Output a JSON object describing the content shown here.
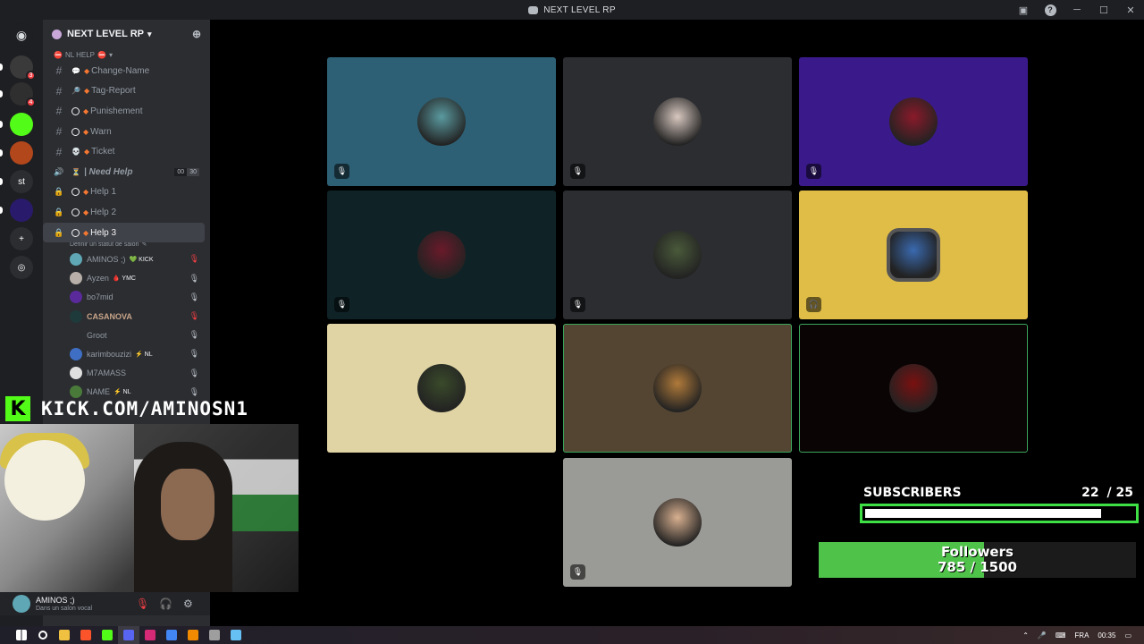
{
  "window": {
    "title": "NEXT LEVEL RP"
  },
  "server": {
    "name": "NEXT LEVEL RP",
    "category": "NL HELP"
  },
  "server_rail": {
    "items": [
      {
        "icon": "discord-home-icon",
        "color": "#1e1f22"
      },
      {
        "icon": "server-icon",
        "color": "#3a3a3a",
        "badge": "3"
      },
      {
        "icon": "server-icon",
        "color": "#2f2f2f",
        "badge": "4"
      },
      {
        "icon": "kick-server-icon",
        "color": "#53fc18"
      },
      {
        "icon": "server-icon",
        "color": "#b3471c"
      },
      {
        "icon": "server-icon",
        "color": "#2b2d31",
        "label": "st"
      },
      {
        "icon": "server-icon",
        "color": "#2a1a6b"
      },
      {
        "icon": "add-server-icon",
        "color": "#2b2d31",
        "label": "+"
      },
      {
        "icon": "explore-icon",
        "color": "#2b2d31",
        "label": "◎"
      }
    ]
  },
  "channels": [
    {
      "type": "text",
      "name": "Change-Name",
      "emoji": "speech"
    },
    {
      "type": "text",
      "name": "Tag-Report",
      "emoji": "magnifier"
    },
    {
      "type": "text",
      "name": "Punishement",
      "emoji": "ban"
    },
    {
      "type": "text",
      "name": "Warn",
      "emoji": "ban"
    },
    {
      "type": "text",
      "name": "Ticket",
      "emoji": "skull"
    },
    {
      "type": "voice",
      "name": "| Need Help",
      "emoji": "hourglass",
      "count": "00",
      "limit": "30"
    },
    {
      "type": "locked",
      "name": "Help 1",
      "emoji": "ban"
    },
    {
      "type": "locked",
      "name": "Help 2",
      "emoji": "ban"
    },
    {
      "type": "locked",
      "name": "Help 3",
      "emoji": "ban",
      "active": true
    }
  ],
  "active_channel_status": "Définir un statut de salon",
  "voice_users": [
    {
      "name": "AMINOS ;)",
      "tag": "💚 KICK",
      "color": "#5fa7b5",
      "muted_red": true
    },
    {
      "name": "Ayzen",
      "tag": "🩸 YMC",
      "color": "#b8b0a8",
      "muted_red": false
    },
    {
      "name": "bo7mid",
      "tag": "",
      "color": "#5b2a9a",
      "muted_red": false
    },
    {
      "name": "CASANOVA",
      "tag": "",
      "color": "#1f3a3a",
      "muted_red": true
    },
    {
      "name": "Groot",
      "tag": "",
      "color": "#2b2d31",
      "muted_red": false
    },
    {
      "name": "karimbouzizi",
      "tag": "⚡ NL",
      "color": "#3f6fc4",
      "muted_red": false
    },
    {
      "name": "M7AMASS",
      "tag": "",
      "color": "#e0e0e0",
      "muted_red": false
    },
    {
      "name": "NAME",
      "tag": "⚡ NL",
      "color": "#4a7a3a",
      "muted_red": false
    }
  ],
  "userbar": {
    "name": "AMINOS ;)",
    "status": "Dans un salon vocal"
  },
  "tiles": [
    {
      "bg": "#2d6074",
      "avatar": "#5a9aa0",
      "mic": "🎙",
      "speaking": false
    },
    {
      "bg": "#2b2d31",
      "avatar": "#d8c8c0",
      "mic": "🎙",
      "speaking": false
    },
    {
      "bg": "#3a1a8a",
      "avatar": "#8a1a2a",
      "mic": "🎙",
      "speaking": false
    },
    {
      "bg": "#0f2226",
      "avatar": "#6a1a2a",
      "mic": "🎙",
      "speaking": false
    },
    {
      "bg": "#2b2d31",
      "avatar": "#4a5a3a",
      "mic": "🎙",
      "speaking": false
    },
    {
      "bg": "#e0bd47",
      "avatar": "#3a6ab0",
      "mic": "🎧",
      "speaking": false
    },
    {
      "bg": "#e0d4a4",
      "avatar": "#3a4a2a",
      "mic": "",
      "speaking": false
    },
    {
      "bg": "#534532",
      "avatar": "#b07a3a",
      "mic": "",
      "speaking": true
    },
    {
      "bg": "#0b0405",
      "avatar": "#7a1010",
      "mic": "",
      "speaking": true
    },
    {
      "bg": "#9a9a96",
      "avatar": "#d8b090",
      "mic": "🎙",
      "speaking": false
    }
  ],
  "overlay": {
    "kick_logo": "K",
    "kick_url": "KICK.COM/AMINOSN1",
    "subscribers_label": "SUBSCRIBERS",
    "subscribers_current": "22",
    "subscribers_goal": "/ 25",
    "subscribers_fraction": 0.88,
    "followers_label": "Followers",
    "followers_count": "785 / 1500",
    "followers_fraction": 0.52
  },
  "taskbar": {
    "lang": "FRA",
    "time": "00:35",
    "apps": [
      "windows-icon",
      "search-icon",
      "file-explorer-icon",
      "brave-icon",
      "kick-app-icon",
      "discord-icon",
      "instagram-icon",
      "chrome-icon",
      "vlc-icon",
      "obs-icon",
      "steam-icon"
    ]
  }
}
